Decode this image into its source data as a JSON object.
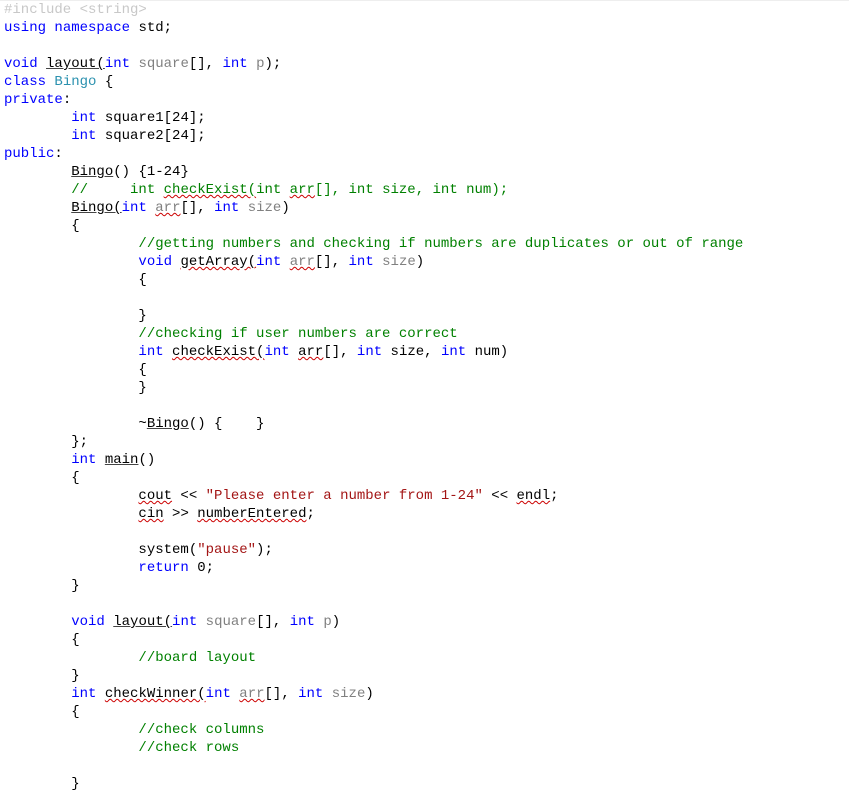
{
  "colors": {
    "keyword": "#0000ff",
    "type": "#2b91af",
    "comment": "#008000",
    "string": "#a31515",
    "gray": "#808080",
    "squiggle": "#cc0000"
  },
  "code_lines": [
    {
      "segments": [
        {
          "t": "#include ",
          "c": "faded"
        },
        {
          "t": "<string>",
          "c": "faded"
        }
      ]
    },
    {
      "segments": [
        {
          "t": "using",
          "c": "kw"
        },
        {
          "t": " "
        },
        {
          "t": "namespace",
          "c": "kw"
        },
        {
          "t": " std;"
        }
      ]
    },
    {
      "segments": [
        {
          "t": " "
        }
      ]
    },
    {
      "segments": [
        {
          "t": "void",
          "c": "kw"
        },
        {
          "t": " "
        },
        {
          "t": "layout(",
          "c": "ul"
        },
        {
          "t": "int",
          "c": "kw"
        },
        {
          "t": " "
        },
        {
          "t": "square",
          "c": "gray"
        },
        {
          "t": "[], ",
          "c": ""
        },
        {
          "t": "int",
          "c": "kw"
        },
        {
          "t": " "
        },
        {
          "t": "p",
          "c": "gray"
        },
        {
          "t": ");"
        }
      ]
    },
    {
      "segments": [
        {
          "t": "class",
          "c": "kw"
        },
        {
          "t": " "
        },
        {
          "t": "Bingo",
          "c": "type"
        },
        {
          "t": " {"
        }
      ]
    },
    {
      "segments": [
        {
          "t": "private",
          "c": "kw"
        },
        {
          "t": ":"
        }
      ]
    },
    {
      "segments": [
        {
          "t": "        "
        },
        {
          "t": "int",
          "c": "kw"
        },
        {
          "t": " square1[24];"
        }
      ]
    },
    {
      "segments": [
        {
          "t": "        "
        },
        {
          "t": "int",
          "c": "kw"
        },
        {
          "t": " square2[24];"
        }
      ]
    },
    {
      "segments": [
        {
          "t": "public",
          "c": "kw"
        },
        {
          "t": ":"
        }
      ]
    },
    {
      "segments": [
        {
          "t": "        "
        },
        {
          "t": "Bingo",
          "c": "ul"
        },
        {
          "t": "() {1-24}"
        }
      ]
    },
    {
      "segments": [
        {
          "t": "        "
        },
        {
          "t": "//     int ",
          "c": "com"
        },
        {
          "t": "checkExist(",
          "c": "com squig"
        },
        {
          "t": "int ",
          "c": "com"
        },
        {
          "t": "arr",
          "c": "com squig"
        },
        {
          "t": "[], int size, int num);",
          "c": "com"
        }
      ]
    },
    {
      "segments": [
        {
          "t": "        "
        },
        {
          "t": "Bingo(",
          "c": "ul"
        },
        {
          "t": "int",
          "c": "kw"
        },
        {
          "t": " "
        },
        {
          "t": "arr",
          "c": "gray squig"
        },
        {
          "t": "[], ",
          "c": ""
        },
        {
          "t": "int",
          "c": "kw"
        },
        {
          "t": " "
        },
        {
          "t": "size",
          "c": "gray"
        },
        {
          "t": ")"
        }
      ]
    },
    {
      "segments": [
        {
          "t": "        {"
        }
      ]
    },
    {
      "segments": [
        {
          "t": "                "
        },
        {
          "t": "//getting numbers and checking if numbers are duplicates or out of range",
          "c": "com"
        }
      ]
    },
    {
      "segments": [
        {
          "t": "                "
        },
        {
          "t": "void",
          "c": "kw"
        },
        {
          "t": " "
        },
        {
          "t": "getArray(",
          "c": "ul squig"
        },
        {
          "t": "int",
          "c": "kw"
        },
        {
          "t": " "
        },
        {
          "t": "arr",
          "c": "gray squig"
        },
        {
          "t": "[], ",
          "c": ""
        },
        {
          "t": "int",
          "c": "kw"
        },
        {
          "t": " "
        },
        {
          "t": "size",
          "c": "gray"
        },
        {
          "t": ")"
        }
      ]
    },
    {
      "segments": [
        {
          "t": "                {"
        }
      ]
    },
    {
      "segments": [
        {
          "t": " "
        }
      ]
    },
    {
      "segments": [
        {
          "t": "                }"
        }
      ]
    },
    {
      "segments": [
        {
          "t": "                "
        },
        {
          "t": "//checking if user numbers are correct",
          "c": "com"
        }
      ]
    },
    {
      "segments": [
        {
          "t": "                "
        },
        {
          "t": "int",
          "c": "kw"
        },
        {
          "t": " "
        },
        {
          "t": "checkExist(",
          "c": "ul squig"
        },
        {
          "t": "int",
          "c": "kw"
        },
        {
          "t": " "
        },
        {
          "t": "arr",
          "c": "squig"
        },
        {
          "t": "[], ",
          "c": ""
        },
        {
          "t": "int",
          "c": "kw"
        },
        {
          "t": " size, "
        },
        {
          "t": "int",
          "c": "kw"
        },
        {
          "t": " num)"
        }
      ]
    },
    {
      "segments": [
        {
          "t": "                {"
        }
      ]
    },
    {
      "segments": [
        {
          "t": "                }"
        }
      ]
    },
    {
      "segments": [
        {
          "t": " "
        }
      ]
    },
    {
      "segments": [
        {
          "t": "                ~"
        },
        {
          "t": "Bingo",
          "c": "ul"
        },
        {
          "t": "() {    }"
        }
      ]
    },
    {
      "segments": [
        {
          "t": "        };"
        }
      ]
    },
    {
      "segments": [
        {
          "t": "        "
        },
        {
          "t": "int",
          "c": "kw"
        },
        {
          "t": " "
        },
        {
          "t": "main",
          "c": "ul"
        },
        {
          "t": "()"
        }
      ]
    },
    {
      "segments": [
        {
          "t": "        {"
        }
      ]
    },
    {
      "segments": [
        {
          "t": "                "
        },
        {
          "t": "cout",
          "c": "squig"
        },
        {
          "t": " << "
        },
        {
          "t": "\"Please enter a number from 1-24\"",
          "c": "str"
        },
        {
          "t": " << "
        },
        {
          "t": "endl",
          "c": "squig"
        },
        {
          "t": ";"
        }
      ]
    },
    {
      "segments": [
        {
          "t": "                "
        },
        {
          "t": "cin",
          "c": "squig"
        },
        {
          "t": " >> "
        },
        {
          "t": "numberEntered",
          "c": "squig"
        },
        {
          "t": ";"
        }
      ]
    },
    {
      "segments": [
        {
          "t": " "
        }
      ]
    },
    {
      "segments": [
        {
          "t": "                system("
        },
        {
          "t": "\"pause\"",
          "c": "str"
        },
        {
          "t": ");"
        }
      ]
    },
    {
      "segments": [
        {
          "t": "                "
        },
        {
          "t": "return",
          "c": "kw"
        },
        {
          "t": " 0;"
        }
      ]
    },
    {
      "segments": [
        {
          "t": "        }"
        }
      ]
    },
    {
      "segments": [
        {
          "t": " "
        }
      ]
    },
    {
      "segments": [
        {
          "t": "        "
        },
        {
          "t": "void",
          "c": "kw"
        },
        {
          "t": " "
        },
        {
          "t": "layout(",
          "c": "ul"
        },
        {
          "t": "int",
          "c": "kw"
        },
        {
          "t": " "
        },
        {
          "t": "square",
          "c": "gray"
        },
        {
          "t": "[], ",
          "c": ""
        },
        {
          "t": "int",
          "c": "kw"
        },
        {
          "t": " "
        },
        {
          "t": "p",
          "c": "gray"
        },
        {
          "t": ")"
        }
      ]
    },
    {
      "segments": [
        {
          "t": "        {"
        }
      ]
    },
    {
      "segments": [
        {
          "t": "                "
        },
        {
          "t": "//board layout",
          "c": "com"
        }
      ]
    },
    {
      "segments": [
        {
          "t": "        }"
        }
      ]
    },
    {
      "segments": [
        {
          "t": "        "
        },
        {
          "t": "int",
          "c": "kw"
        },
        {
          "t": " "
        },
        {
          "t": "checkWinner(",
          "c": "ul squig"
        },
        {
          "t": "int",
          "c": "kw"
        },
        {
          "t": " "
        },
        {
          "t": "arr",
          "c": "gray squig"
        },
        {
          "t": "[], ",
          "c": ""
        },
        {
          "t": "int",
          "c": "kw"
        },
        {
          "t": " "
        },
        {
          "t": "size",
          "c": "gray"
        },
        {
          "t": ")"
        }
      ]
    },
    {
      "segments": [
        {
          "t": "        {"
        }
      ]
    },
    {
      "segments": [
        {
          "t": "                "
        },
        {
          "t": "//check columns",
          "c": "com"
        }
      ]
    },
    {
      "segments": [
        {
          "t": "                "
        },
        {
          "t": "//check rows",
          "c": "com"
        }
      ]
    },
    {
      "segments": [
        {
          "t": " "
        }
      ]
    },
    {
      "segments": [
        {
          "t": "        }"
        }
      ]
    }
  ]
}
